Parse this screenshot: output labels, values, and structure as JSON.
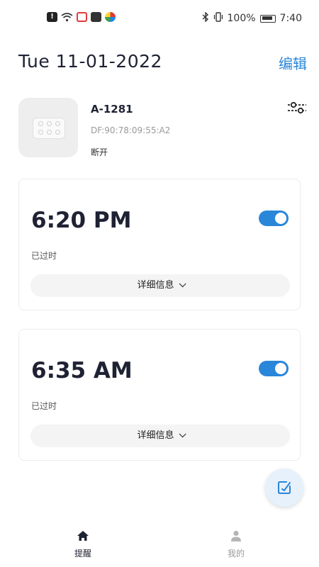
{
  "status_bar": {
    "battery_text": "100%",
    "time": "7:40"
  },
  "header": {
    "date": "Tue 11-01-2022",
    "edit_label": "编辑"
  },
  "device": {
    "name": "A-1281",
    "mac": "DF:90:78:09:55:A2",
    "status": "断开"
  },
  "alarms": [
    {
      "time": "6:20 PM",
      "status": "已过时",
      "details_label": "详细信息",
      "enabled": true
    },
    {
      "time": "6:35 AM",
      "status": "已过时",
      "details_label": "详细信息",
      "enabled": true
    }
  ],
  "nav": {
    "items": [
      {
        "label": "提醒",
        "icon": "home-icon",
        "active": true
      },
      {
        "label": "我的",
        "icon": "user-icon",
        "active": false
      }
    ]
  },
  "colors": {
    "accent": "#2a86d9",
    "text_dark": "#1e2233",
    "muted": "#9a9a9a"
  }
}
